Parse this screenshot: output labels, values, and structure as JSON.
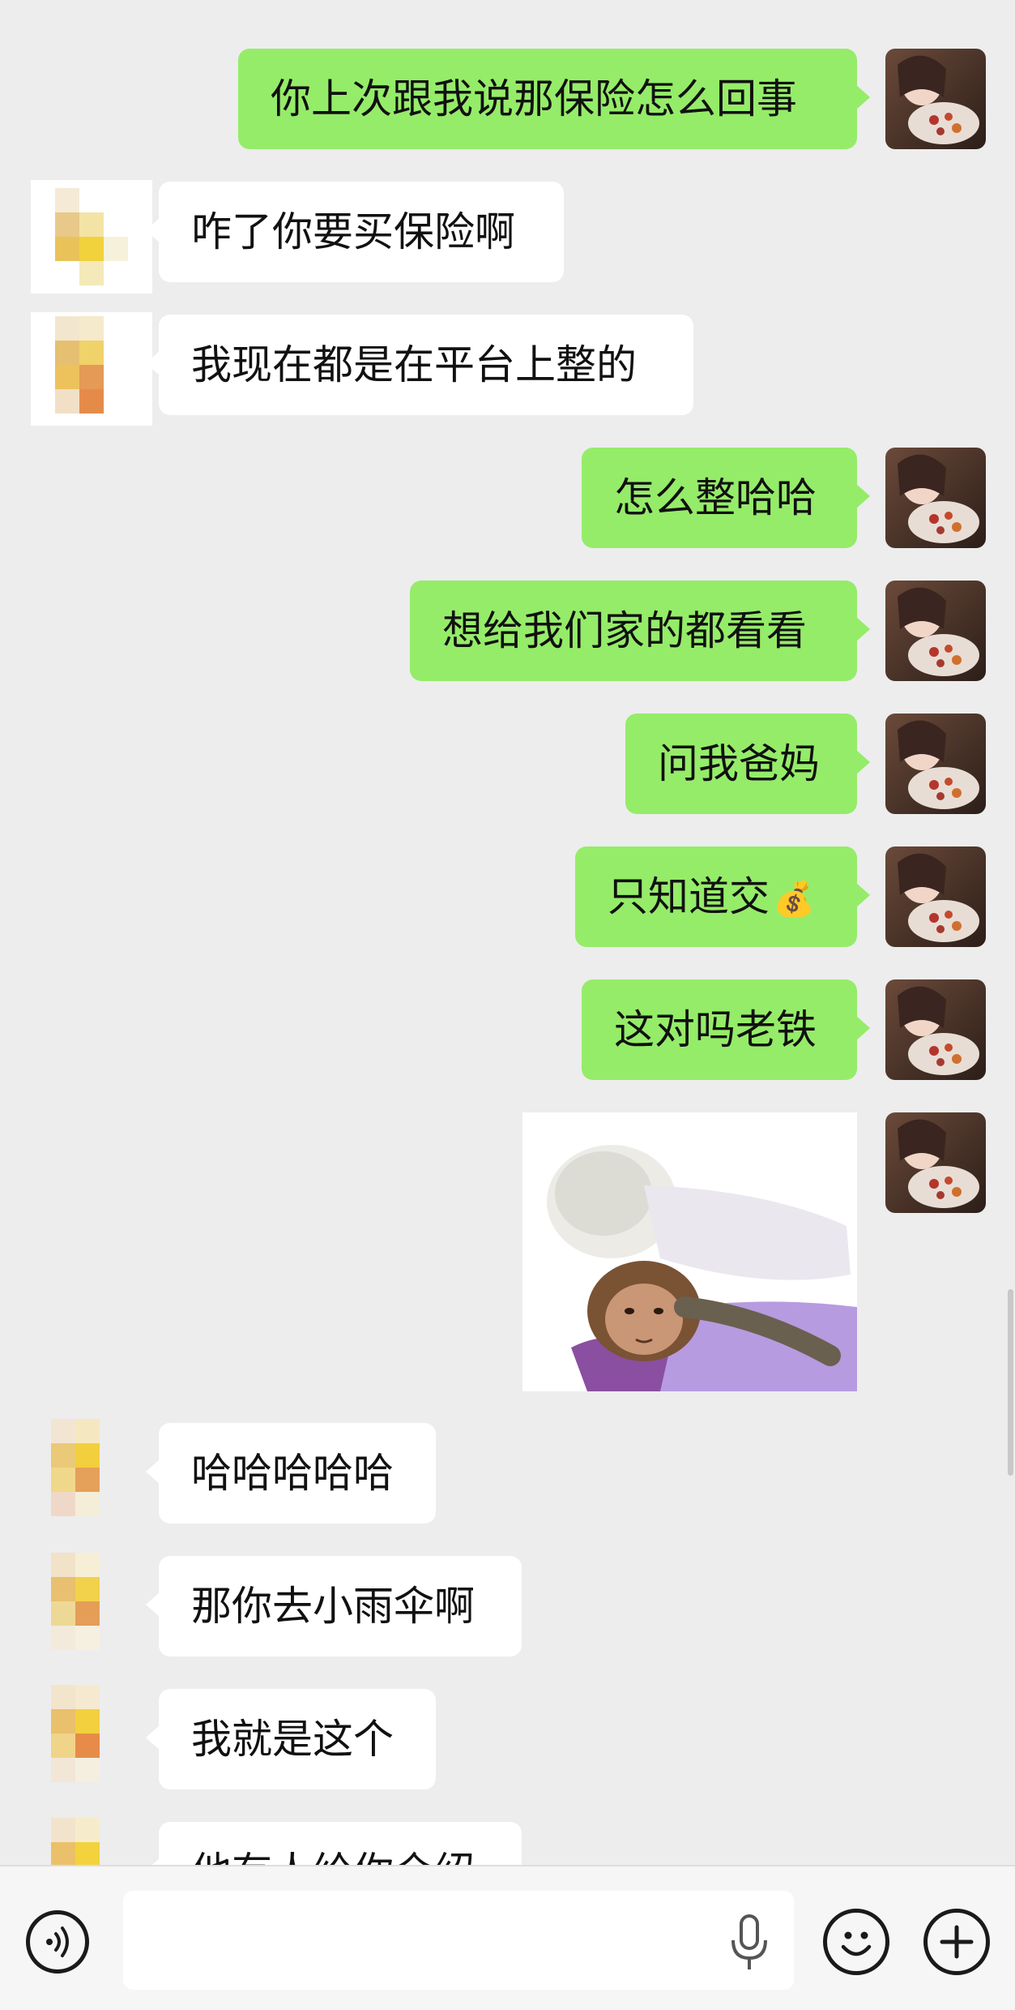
{
  "messages": [
    {
      "text": "你上次跟我说那保险怎么回事",
      "from": "me"
    },
    {
      "text": "咋了你要买保险啊",
      "from": "them"
    },
    {
      "text": "我现在都是在平台上整的",
      "from": "them"
    },
    {
      "text": "怎么整哈哈",
      "from": "me"
    },
    {
      "text": "想给我们家的都看看",
      "from": "me"
    },
    {
      "text": "问我爸妈",
      "from": "me"
    },
    {
      "text": "只知道交",
      "emoji": "💰",
      "from": "me"
    },
    {
      "text": "这对吗老铁",
      "from": "me"
    },
    {
      "sticker": "monkey-hugging-doll",
      "from": "me"
    },
    {
      "text": "哈哈哈哈哈",
      "from": "them"
    },
    {
      "text": "那你去小雨伞啊",
      "from": "them"
    },
    {
      "text": "我就是这个",
      "from": "them"
    },
    {
      "text": "他有人给你介绍",
      "from": "them",
      "partially_visible": true
    }
  ],
  "input_bar": {
    "value": "",
    "icons": [
      "voice-icon",
      "mic-icon",
      "emoji-icon",
      "plus-icon"
    ]
  },
  "colors": {
    "background": "#ededed",
    "my_bubble": "#95ec69",
    "their_bubble": "#ffffff"
  }
}
